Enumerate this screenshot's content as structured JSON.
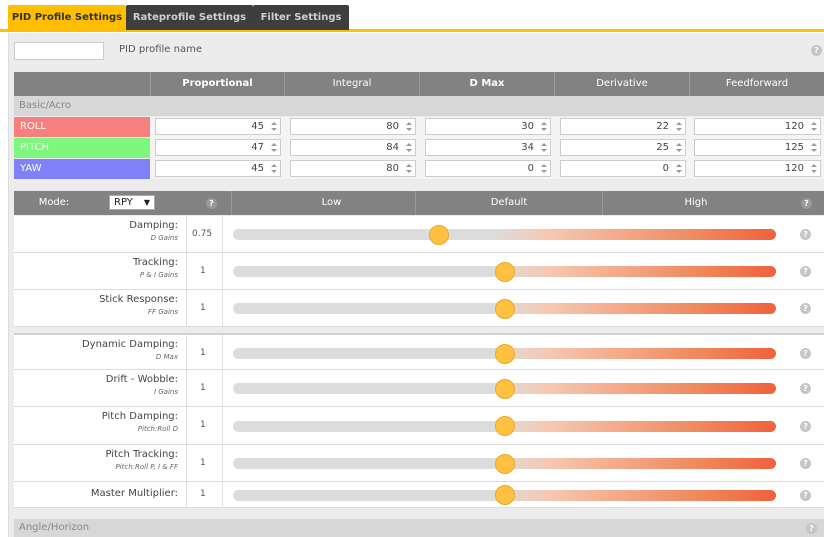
{
  "tabs": [
    {
      "label": "PID Profile Settings",
      "active": true
    },
    {
      "label": "Rateprofile Settings",
      "active": false
    },
    {
      "label": "Filter Settings",
      "active": false
    }
  ],
  "profile_name": {
    "label": "PID profile name",
    "value": ""
  },
  "pid_table": {
    "headers": [
      "Proportional",
      "Integral",
      "D Max",
      "Derivative",
      "Feedforward"
    ],
    "section_label": "Basic/Acro",
    "rows": [
      {
        "axis": "ROLL",
        "color": "#f77f7f",
        "values": [
          "45",
          "80",
          "30",
          "22",
          "120"
        ]
      },
      {
        "axis": "PITCH",
        "color": "#7ff77f",
        "values": [
          "47",
          "84",
          "34",
          "25",
          "125"
        ]
      },
      {
        "axis": "YAW",
        "color": "#8080f8",
        "values": [
          "45",
          "80",
          "0",
          "0",
          "120"
        ]
      }
    ]
  },
  "sliders": {
    "mode_label": "Mode:",
    "mode_value": "RPY",
    "headers": {
      "low": "Low",
      "default": "Default",
      "high": "High"
    },
    "rows": [
      {
        "label": "Damping:",
        "sub": "D Gains",
        "value": "0.75",
        "position": 0.38
      },
      {
        "label": "Tracking:",
        "sub": "P & I Gains",
        "value": "1",
        "position": 0.5
      },
      {
        "label": "Stick Response:",
        "sub": "FF Gains",
        "value": "1",
        "position": 0.5
      },
      {
        "label": "Dynamic Damping:",
        "sub": "D Max",
        "value": "1",
        "position": 0.5
      },
      {
        "label": "Drift - Wobble:",
        "sub": "I Gains",
        "value": "1",
        "position": 0.5
      },
      {
        "label": "Pitch Damping:",
        "sub": "Pitch:Roll D",
        "value": "1",
        "position": 0.5
      },
      {
        "label": "Pitch Tracking:",
        "sub": "Pitch:Roll P, I & FF",
        "value": "1",
        "position": 0.5
      },
      {
        "label": "Master Multiplier:",
        "sub": "",
        "value": "1",
        "position": 0.5
      }
    ]
  },
  "footer_section": "Angle/Horizon",
  "help_icon": "?"
}
